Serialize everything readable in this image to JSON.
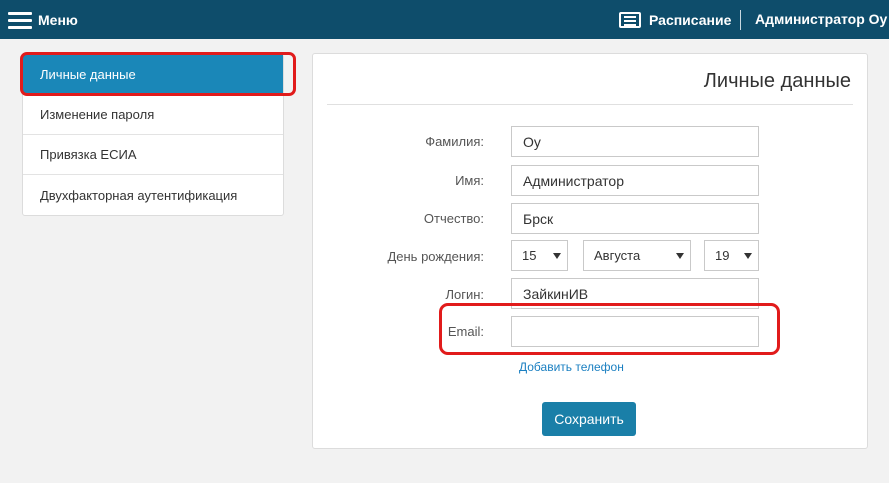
{
  "topbar": {
    "menu_label": "Меню",
    "schedule_label": "Расписание",
    "user_name": "Администратор Оу",
    "background": "#0e4d6b"
  },
  "sidebar": {
    "items": [
      {
        "label": "Личные данные",
        "active": true
      },
      {
        "label": "Изменение пароля",
        "active": false
      },
      {
        "label": "Привязка ЕСИА",
        "active": false
      },
      {
        "label": "Двухфакторная аутентификация",
        "active": false
      }
    ],
    "active_color": "#1a87b8"
  },
  "form": {
    "title": "Личные данные",
    "fields": {
      "lastname": {
        "label": "Фамилия:",
        "value": "Оу"
      },
      "firstname": {
        "label": "Имя:",
        "value": "Администратор"
      },
      "patronymic": {
        "label": "Отчество:",
        "value": "Брск"
      },
      "birthday": {
        "label": "День рождения:",
        "day": "15",
        "month": "Августа",
        "year": "19"
      },
      "login": {
        "label": "Логин:",
        "value": "ЗайкинИВ"
      },
      "email": {
        "label": "Email:",
        "value": ""
      }
    },
    "add_phone_label": "Добавить телефон",
    "save_label": "Сохранить",
    "highlight_color": "#e11b1b"
  },
  "icons": {
    "menu": "hamburger-icon",
    "schedule": "schedule-icon",
    "dropdown": "chevron-down-icon"
  }
}
